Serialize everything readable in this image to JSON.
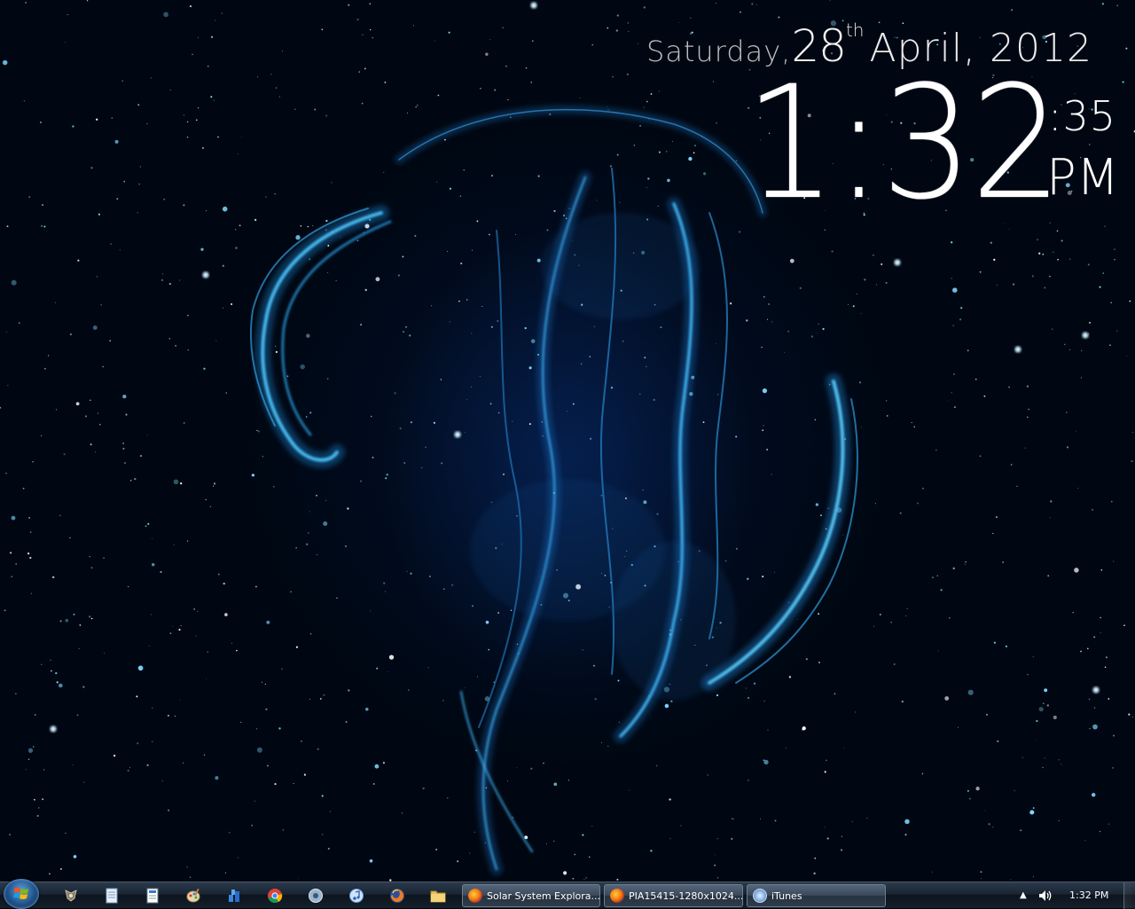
{
  "clock": {
    "day": "Saturday,",
    "date_num": "28",
    "date_suffix": "th",
    "month_year": "April, 2012",
    "time": "1:32",
    "seconds": ":35",
    "ampm": "PM"
  },
  "taskbar": {
    "quick_launch": [
      {
        "name": "gimp-icon"
      },
      {
        "name": "notepad-icon"
      },
      {
        "name": "document-icon"
      },
      {
        "name": "paint-icon"
      },
      {
        "name": "network-icon"
      },
      {
        "name": "chrome-icon"
      },
      {
        "name": "audio-icon"
      },
      {
        "name": "itunes-icon"
      },
      {
        "name": "firefox-icon"
      },
      {
        "name": "folder-icon"
      }
    ],
    "tasks": [
      {
        "label": "Solar System Explora..."
      },
      {
        "label": "PIA15415-1280x1024...."
      },
      {
        "label": "iTunes"
      }
    ],
    "tray_time": "1:32 PM"
  }
}
